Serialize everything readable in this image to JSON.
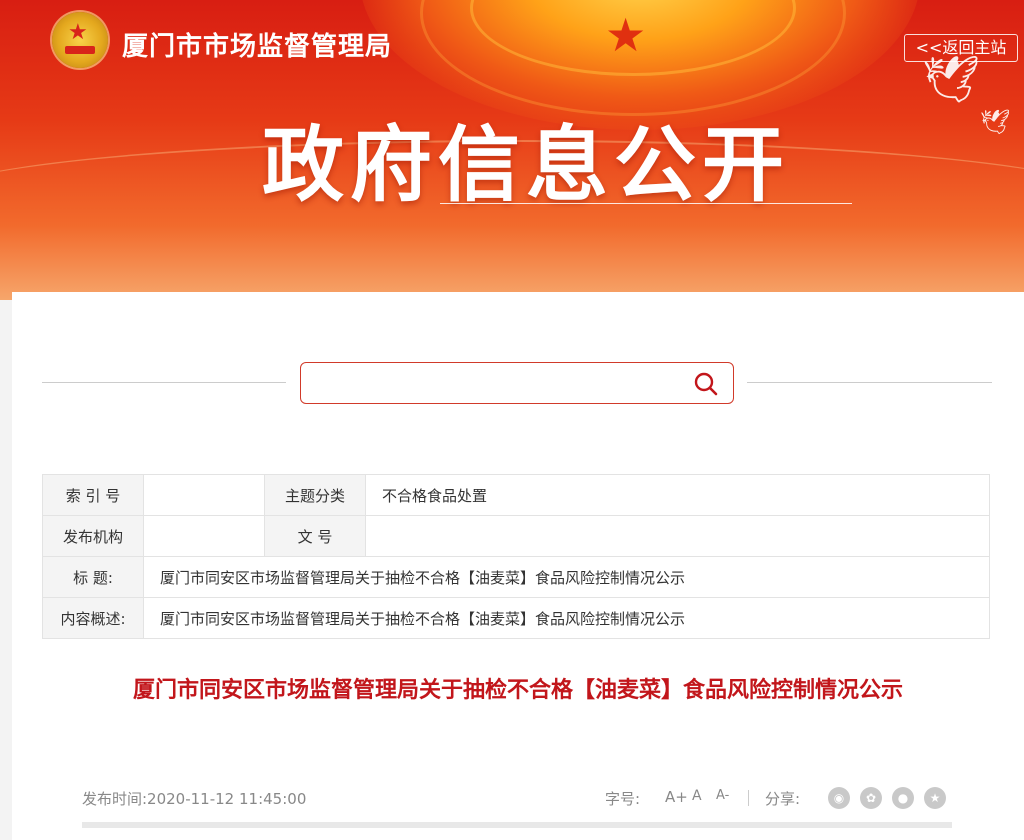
{
  "header": {
    "org_name": "厦门市市场监督管理局",
    "back_label": "<<返回主站",
    "page_title": "政府信息公开"
  },
  "search": {
    "value": "",
    "placeholder": ""
  },
  "info_table": {
    "index_label": "索 引 号",
    "index_value": "",
    "topic_label": "主题分类",
    "topic_value": "不合格食品处置",
    "issuer_label": "发布机构",
    "issuer_value": "",
    "docno_label": "文 号",
    "docno_value": "",
    "title_label": "标 题:",
    "title_value": "厦门市同安区市场监督管理局关于抽检不合格【油麦菜】食品风险控制情况公示",
    "summary_label": "内容概述:",
    "summary_value": "厦门市同安区市场监督管理局关于抽检不合格【油麦菜】食品风险控制情况公示"
  },
  "article": {
    "title": "厦门市同安区市场监督管理局关于抽检不合格【油麦菜】食品风险控制情况公示",
    "published": "发布时间:2020-11-12 11:45:00",
    "font_size_label": "字号:",
    "font_sizes": [
      "A+",
      "A",
      "A-"
    ],
    "share_label": "分享:",
    "share_icons": [
      "weibo-icon",
      "wechat-icon",
      "qzone-icon",
      "favorite-icon"
    ]
  },
  "colors": {
    "brand_red": "#c2161b",
    "banner_red": "#d81e12"
  }
}
